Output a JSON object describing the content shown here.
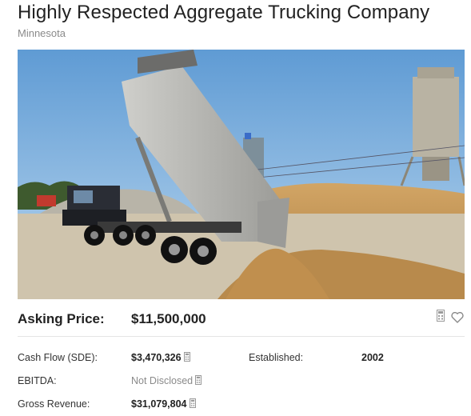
{
  "listing": {
    "title": "Highly Respected Aggregate Trucking Company",
    "location": "Minnesota"
  },
  "photo": {
    "subject": "dump-truck-unloading-sand"
  },
  "pricing": {
    "asking_label": "Asking Price:",
    "asking_value": "$11,500,000"
  },
  "details": {
    "cash_flow_label": "Cash Flow (SDE):",
    "cash_flow_value": "$3,470,326",
    "established_label": "Established:",
    "established_value": "2002",
    "ebitda_label": "EBITDA:",
    "ebitda_value": "Not Disclosed",
    "gross_revenue_label": "Gross Revenue:",
    "gross_revenue_value": "$31,079,804"
  },
  "icons": {
    "favorite": "heart-icon",
    "calculator": "calculator-icon"
  },
  "colors": {
    "sky": "#7fb0dc",
    "sand": "#c99a5a",
    "text": "#222222",
    "muted": "#8a8a8a"
  }
}
